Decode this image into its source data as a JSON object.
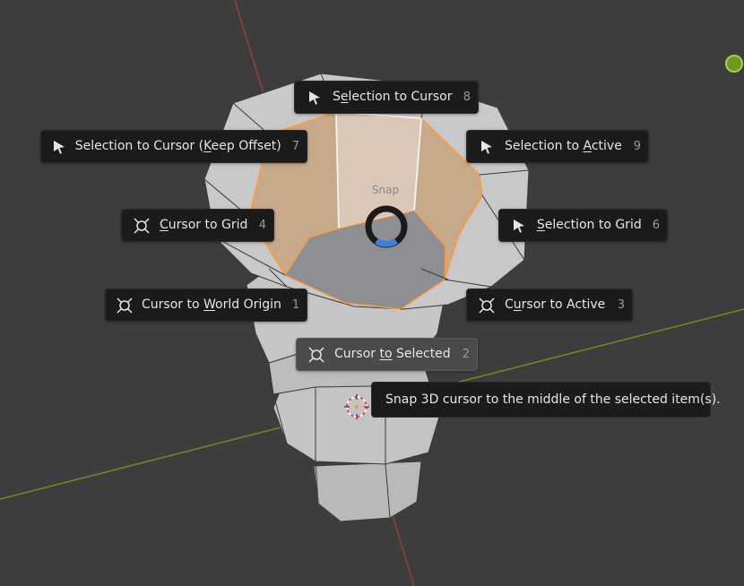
{
  "pie_menu": {
    "title": "Snap",
    "items": [
      {
        "before": "S",
        "mnemonic": "e",
        "after": "lection to Cursor",
        "key": "8",
        "icon": "cursor-arrow-icon"
      },
      {
        "before": "Selection to Cursor (",
        "mnemonic": "K",
        "after": "eep Offset)",
        "key": "7",
        "icon": "cursor-arrow-icon"
      },
      {
        "before": "Selection to ",
        "mnemonic": "A",
        "after": "ctive",
        "key": "9",
        "icon": "cursor-arrow-icon"
      },
      {
        "before": "",
        "mnemonic": "C",
        "after": "ursor to Grid",
        "key": "4",
        "icon": "3d-cursor-icon"
      },
      {
        "before": "",
        "mnemonic": "S",
        "after": "election to Grid",
        "key": "6",
        "icon": "cursor-arrow-icon"
      },
      {
        "before": "Cursor to ",
        "mnemonic": "W",
        "after": "orld Origin",
        "key": "1",
        "icon": "3d-cursor-icon"
      },
      {
        "before": "C",
        "mnemonic": "u",
        "after": "rsor to Active",
        "key": "3",
        "icon": "3d-cursor-icon"
      },
      {
        "before": "Cursor ",
        "mnemonic": "to",
        "after": " Selected",
        "key": "2",
        "icon": "3d-cursor-icon"
      }
    ]
  },
  "tooltip": {
    "text": "Snap 3D cursor to the middle of the selected item(s)."
  },
  "colors": {
    "viewport_bg": "#3d3d3d",
    "axis_x": "#9b3a43",
    "axis_y": "#6b8e23",
    "selection": "#ff9a3c",
    "menu_bg": "#1b1b1b",
    "menu_active_bg": "#4a4a4a",
    "pie_indicator": "#3d7fd6"
  }
}
